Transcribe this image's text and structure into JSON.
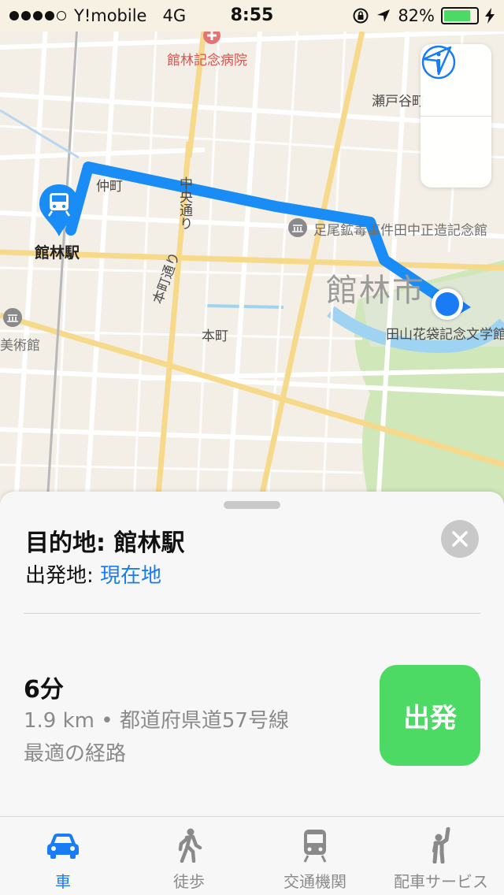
{
  "status_bar": {
    "carrier": "Y!mobile",
    "network": "4G",
    "time": "8:55",
    "battery_percent": "82%",
    "battery_level": 0.82,
    "icons": [
      "signal-icon",
      "lock-rotation-icon",
      "location-arrow-icon",
      "battery-icon",
      "charging-icon"
    ]
  },
  "map": {
    "labels": {
      "hospital": "館林記念病院",
      "setoya": "瀬戸谷町",
      "nakamachi": "仲町",
      "chuo_dori": "中央通り",
      "museum_poi": "足尾鉱毒事件田中正造記念館",
      "city": "館林市",
      "bungakukan": "田山花袋記念文学館",
      "bijutsukan": "美術館",
      "honmachi_dori": "本町通り",
      "honmachi": "本町",
      "station": "館林駅"
    },
    "route_color": "#1a8cf5",
    "controls": {
      "info_icon": "info-icon",
      "location_icon": "location-arrow-icon"
    }
  },
  "card": {
    "destination_label": "目的地: 館林駅",
    "origin_prefix": "出発地: ",
    "origin_value": "現在地",
    "duration": "6分",
    "route_detail": "1.9 km • 都道府県道57号線",
    "route_note": "最適の経路",
    "go_label": "出発"
  },
  "tabs": [
    {
      "label": "車",
      "icon": "car-icon",
      "active": true
    },
    {
      "label": "徒歩",
      "icon": "walking-icon",
      "active": false
    },
    {
      "label": "交通機関",
      "icon": "train-icon",
      "active": false
    },
    {
      "label": "配車サービス",
      "icon": "ride-hail-icon",
      "active": false
    }
  ],
  "colors": {
    "accent": "#1a7cf4",
    "go_button": "#4cd964",
    "park": "#cfe7b9",
    "river": "#9fd3f2",
    "road_major": "#f7d98b"
  }
}
